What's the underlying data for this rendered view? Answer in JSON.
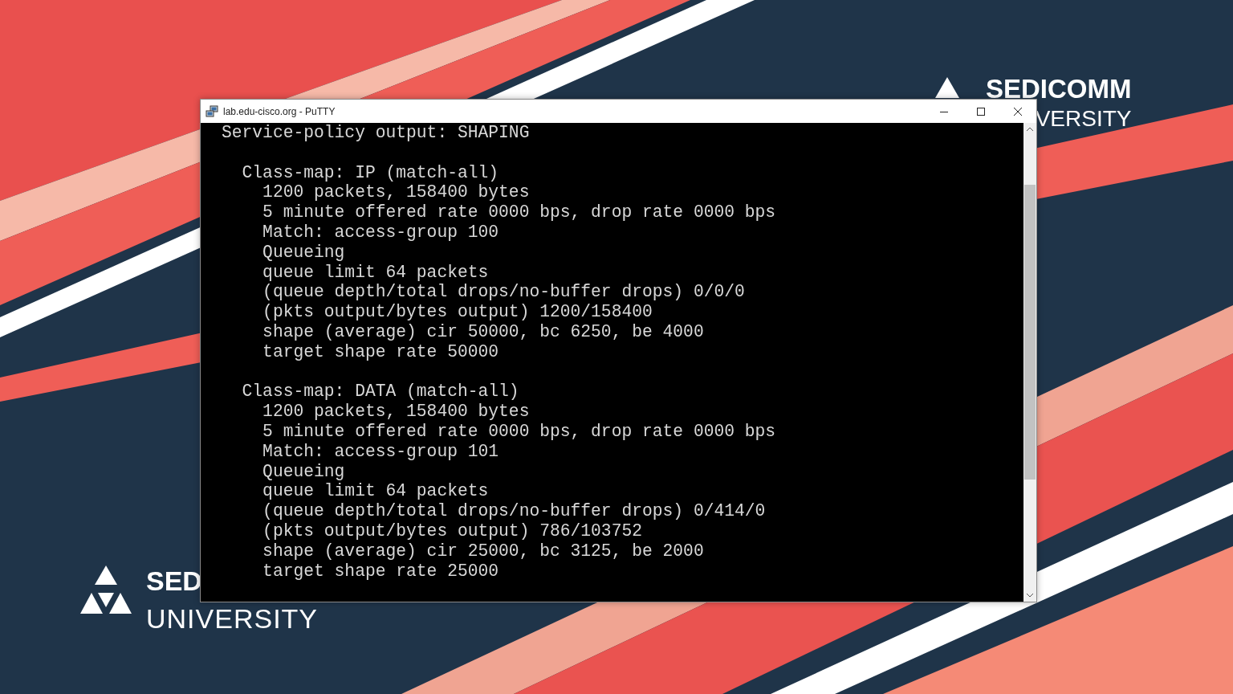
{
  "logos": {
    "top_right": [
      {
        "text": "SEDICOMM",
        "kind": "bold"
      },
      {
        "text": "VERSITY",
        "kind": "light"
      }
    ],
    "bottom_left": [
      {
        "text": "SED",
        "kind": "bold"
      },
      {
        "text": "UNIVERSITY",
        "kind": "light"
      }
    ]
  },
  "window": {
    "title": "lab.edu-cisco.org - PuTTY"
  },
  "terminal": {
    "blocks": [
      {
        "lines": [
          "Service-policy output: SHAPING"
        ]
      },
      {
        "lines": [
          "  Class-map: IP (match-all)",
          "    1200 packets, 158400 bytes",
          "    5 minute offered rate 0000 bps, drop rate 0000 bps",
          "    Match: access-group 100",
          "    Queueing",
          "    queue limit 64 packets",
          "    (queue depth/total drops/no-buffer drops) 0/0/0",
          "    (pkts output/bytes output) 1200/158400",
          "    shape (average) cir 50000, bc 6250, be 4000",
          "    target shape rate 50000"
        ]
      },
      {
        "lines": [
          "  Class-map: DATA (match-all)",
          "    1200 packets, 158400 bytes",
          "    5 minute offered rate 0000 bps, drop rate 0000 bps",
          "    Match: access-group 101",
          "    Queueing",
          "    queue limit 64 packets",
          "    (queue depth/total drops/no-buffer drops) 0/414/0",
          "    (pkts output/bytes output) 786/103752",
          "    shape (average) cir 25000, bc 3125, be 2000",
          "    target shape rate 25000"
        ]
      }
    ]
  }
}
